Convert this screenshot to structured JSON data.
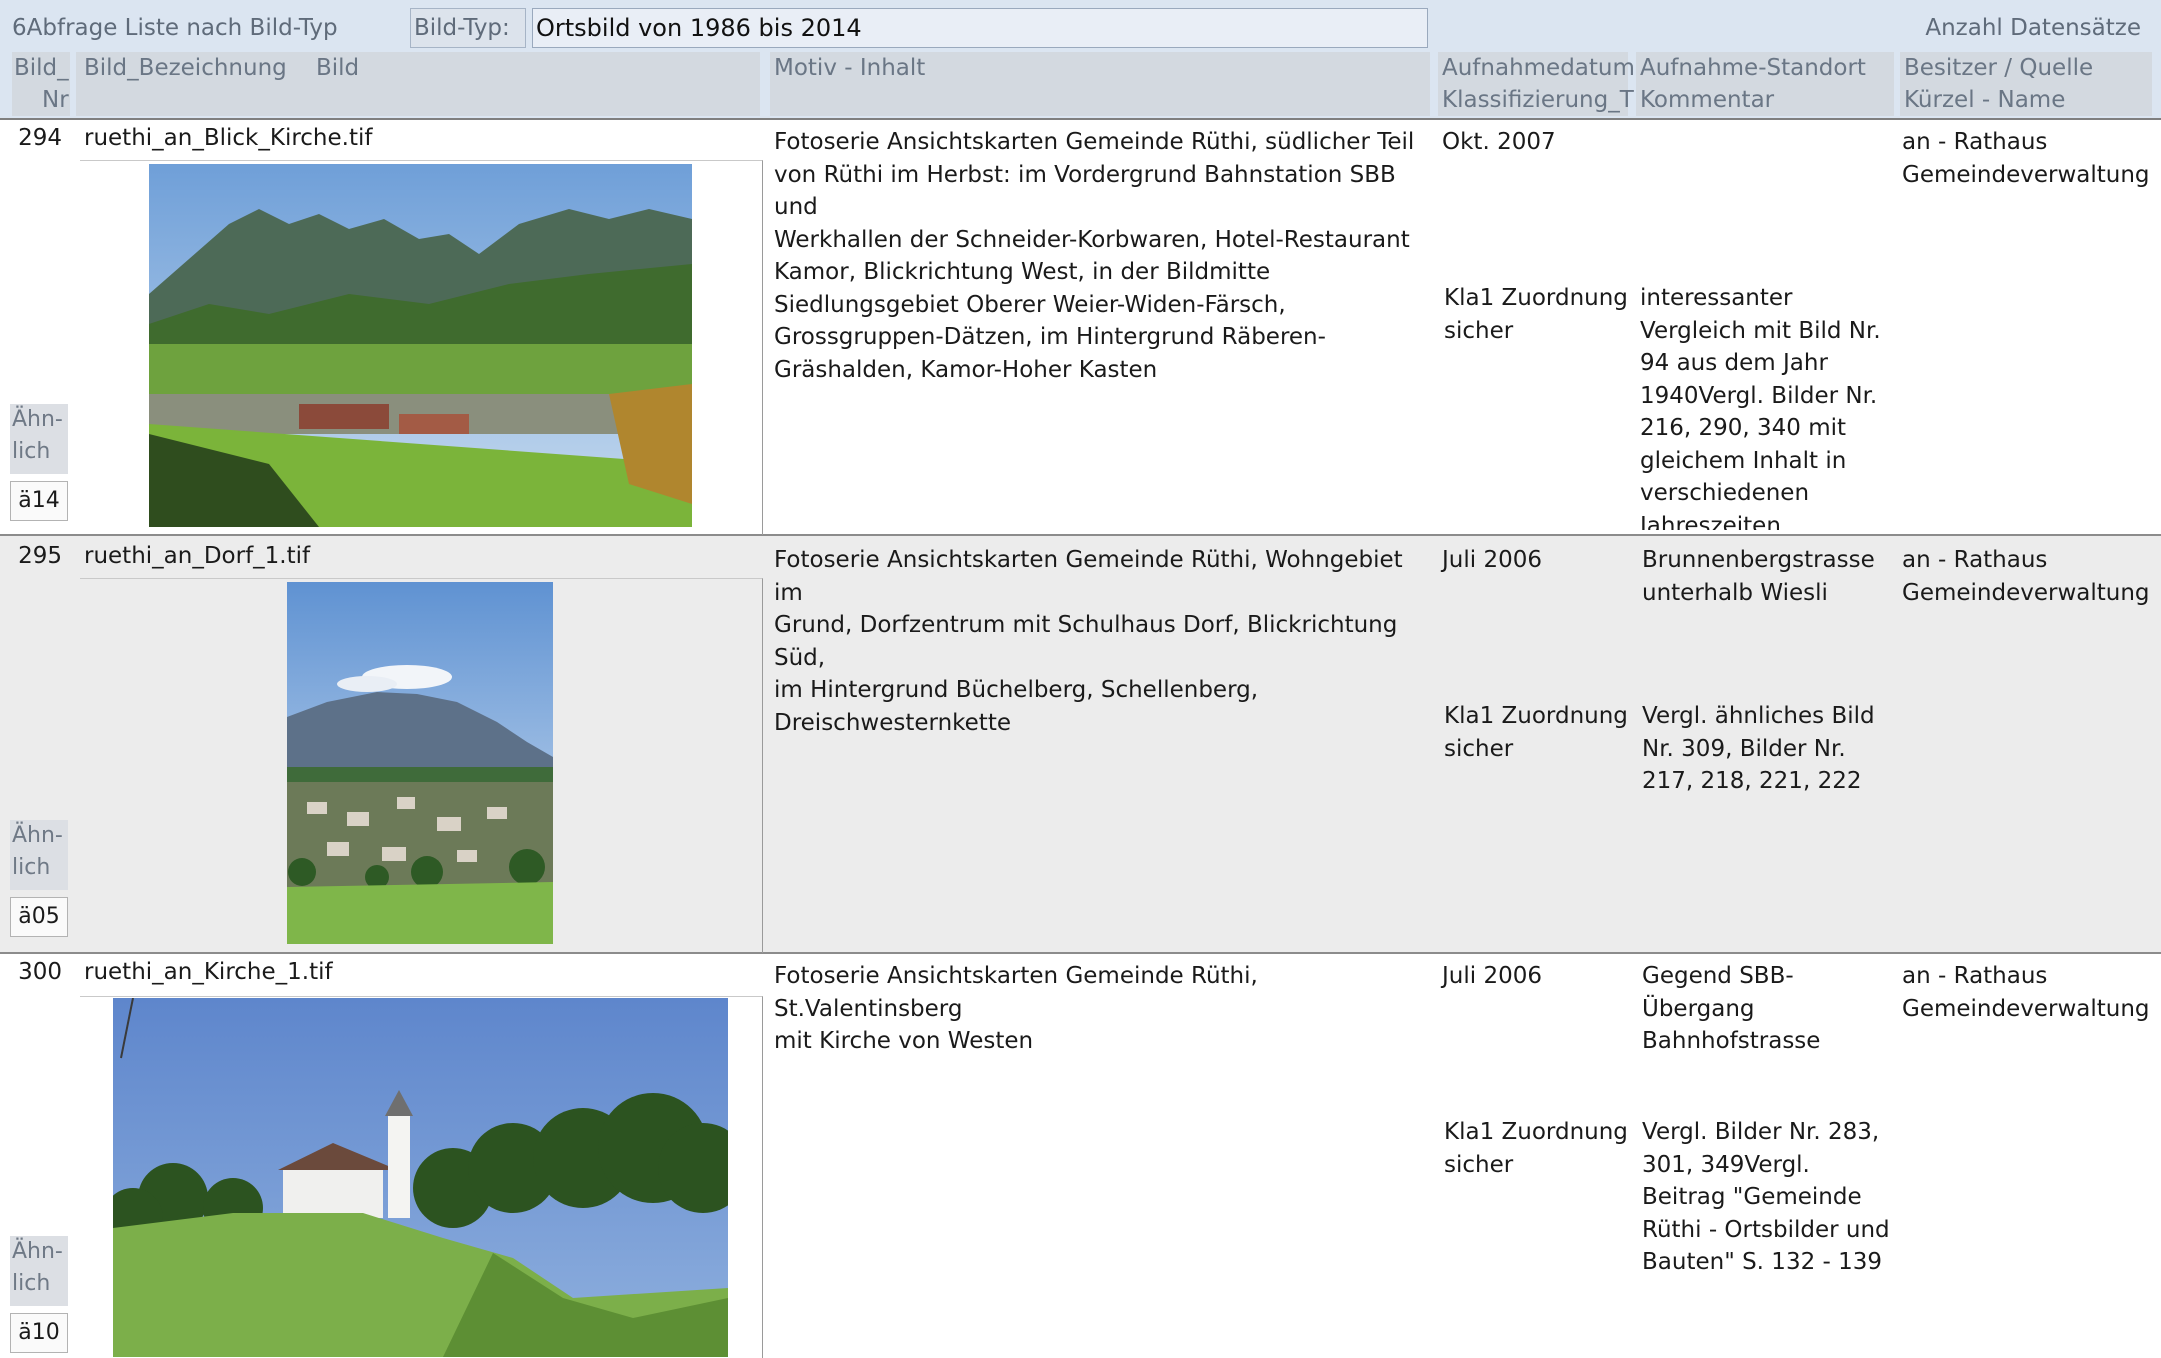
{
  "header": {
    "query_title": "6Abfrage Liste nach Bild-Typ",
    "type_label": "Bild-Typ:",
    "type_value": "Ortsbild von 1986 bis 2014",
    "count_label": "Anzahl Datensätze"
  },
  "columns": {
    "nr_line1": "Bild_",
    "nr_line2": "Nr",
    "bezeichnung": "Bild_Bezeichnung",
    "bild": "Bild",
    "motiv": "Motiv - Inhalt",
    "datum_line1": "Aufnahmedatum",
    "datum_line2": "Klassifizierung_T",
    "standort_line1": "Aufnahme-Standort",
    "standort_line2": "Kommentar",
    "besitzer_line1": "Besitzer / Quelle",
    "besitzer_line2": "Kürzel - Name"
  },
  "records": [
    {
      "nr": "294",
      "filename": "ruethi_an_Blick_Kirche.tif",
      "motiv": "Fotoserie Ansichtskarten Gemeinde Rüthi, südlicher Teil\nvon Rüthi im Herbst: im Vordergrund Bahnstation SBB und\nWerkhallen der Schneider-Korbwaren, Hotel-Restaurant\nKamor, Blickrichtung West,  in der Bildmitte\nSiedlungsgebiet Oberer Weier-Widen-Färsch,\nGrossgruppen-Dätzen, im Hintergrund Räberen-\nGräshalden, Kamor-Hoher Kasten",
      "datum": "Okt. 2007",
      "standort": "",
      "besitzer": "an - Rathaus\nGemeindeverwaltung",
      "klassifizierung": "Kla1 Zuordnung\nsicher",
      "kommentar": "interessanter\nVergleich mit Bild Nr.\n94 aus dem Jahr\n1940Vergl. Bilder Nr.\n216, 290, 340 mit\ngleichem Inhalt in\nverschiedenen\nJahreszeiten",
      "aehnlich_label": "Ähn-\nlich",
      "aehnlich_code": "ä14",
      "image_desc_icon": "photo-landscape-autumn"
    },
    {
      "nr": "295",
      "filename": "ruethi_an_Dorf_1.tif",
      "motiv": "Fotoserie Ansichtskarten Gemeinde Rüthi, Wohngebiet im\nGrund, Dorfzentrum mit Schulhaus Dorf, Blickrichtung Süd,\nim Hintergrund Büchelberg, Schellenberg,\nDreischwesternkette",
      "datum": "Juli 2006",
      "standort": "Brunnenbergstrasse\nunterhalb Wiesli",
      "besitzer": "an - Rathaus\nGemeindeverwaltung",
      "klassifizierung": "Kla1 Zuordnung\nsicher",
      "kommentar": "Vergl. ähnliches Bild\nNr. 309, Bilder Nr.\n217, 218, 221, 222",
      "aehnlich_label": "Ähn-\nlich",
      "aehnlich_code": "ä05",
      "image_desc_icon": "photo-village-portrait"
    },
    {
      "nr": "300",
      "filename": "ruethi_an_Kirche_1.tif",
      "motiv": "Fotoserie Ansichtskarten Gemeinde Rüthi, St.Valentinsberg\nmit Kirche von Westen",
      "datum": "Juli 2006",
      "standort": "Gegend SBB-\nÜbergang\nBahnhofstrasse",
      "besitzer": "an - Rathaus\nGemeindeverwaltung",
      "klassifizierung": "Kla1 Zuordnung\nsicher",
      "kommentar": "Vergl. Bilder Nr. 283,\n301, 349Vergl.\nBeitrag \"Gemeinde\nRüthi - Ortsbilder und\nBauten\" S. 132 - 139",
      "aehnlich_label": "Ähn-\nlich",
      "aehnlich_code": "ä10",
      "image_desc_icon": "photo-church-hill"
    }
  ],
  "colors": {
    "header_bg": "#dbe5f1",
    "column_header_bg": "#d3d9e0",
    "alt_row_bg": "#ececec"
  }
}
